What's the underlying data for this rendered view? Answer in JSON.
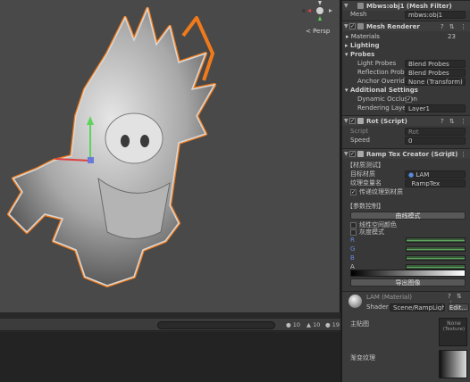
{
  "scene": {
    "persp_label": "< Persp"
  },
  "bottom": {
    "count_1": "10",
    "count_2": "10",
    "count_3": "19"
  },
  "inspector": {
    "mesh_filter": {
      "title": "Mbws:obj1 (Mesh Filter)",
      "mesh_label": "Mesh",
      "mesh_value": "mbws:obj1"
    },
    "mesh_renderer": {
      "title": "Mesh Renderer",
      "materials_label": "Materials",
      "materials_count": "23",
      "lighting_label": "Lighting",
      "probes_label": "Probes",
      "light_probes_label": "Light Probes",
      "light_probes_value": "Blend Probes",
      "reflection_probes_label": "Reflection Probes",
      "reflection_probes_value": "Blend Probes",
      "anchor_override_label": "Anchor Override",
      "anchor_override_value": "None (Transform)",
      "additional_settings_label": "Additional Settings",
      "dynamic_occlusion_label": "Dynamic Occlusion",
      "rendering_layer_label": "Rendering Layer M",
      "rendering_layer_value": "Layer1"
    },
    "rot_script": {
      "title": "Rot (Script)",
      "script_label": "Script",
      "script_value": "Rot",
      "speed_label": "Speed",
      "speed_value": "0"
    },
    "ramp_tex": {
      "title": "Ramp Tex Creator (Script)",
      "section_1": "【材质测试】",
      "target_material_label": "目标材质",
      "target_material_value": "LAM",
      "texture_var_label": "纹理变量名",
      "texture_var_value": "_RampTex",
      "pass_texture_label": "传递纹理到材质",
      "section_2": "【参数控制】",
      "curve_mode_button": "曲线模式",
      "linear_space_label": "线性空间颜色",
      "gray_mode_label": "灰度模式",
      "channel_r": "R",
      "channel_g": "G",
      "channel_b": "B",
      "channel_a": "A",
      "export_button": "导出图像"
    },
    "material": {
      "title": "LAM (Material)",
      "shader_label": "Shader",
      "shader_value": "Scene/RampLight",
      "edit_button": "Edit...",
      "main_tex_label": "主贴图",
      "main_tex_value_1": "None",
      "main_tex_value_2": "(Texture)",
      "ramp_tex_label": "渐变纹理"
    }
  }
}
